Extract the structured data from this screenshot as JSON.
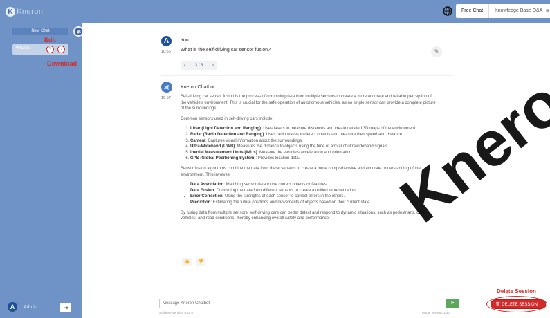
{
  "header": {
    "logo_text": "Kneron",
    "tabs": [
      {
        "label": "Free Chat",
        "active": true
      },
      {
        "label": "Knowledge Base Q&A",
        "active": false
      }
    ],
    "menu_label": "≡"
  },
  "sidebar": {
    "new_chat_label": "New Chat",
    "chat_item_text": "What is",
    "edit_annotation": "Edit",
    "download_annotation": "Download",
    "admin_initial": "A",
    "admin_name": "Admin"
  },
  "conversation": {
    "user": {
      "initial": "A",
      "name": "You :",
      "time": "10:56",
      "text": "What is the self-driving car sensor fusion?",
      "pager": "3 / 3"
    },
    "bot": {
      "name": "Kneron Chatbot :",
      "time": "10:57",
      "intro": "Self-driving car sensor fusion is the process of combining data from multiple sensors to create a more accurate and reliable perception of the vehicle's environment. This is crucial for the safe operation of autonomous vehicles, as no single sensor can provide a complete picture of the surroundings.",
      "sensors_intro": "Common sensors used in self-driving cars include:",
      "sensors": [
        {
          "term": "Lidar (Light Detection and Ranging)",
          "desc": ": Uses lasers to measure distances and create detailed 3D maps of the environment."
        },
        {
          "term": "Radar (Radio Detection and Ranging)",
          "desc": ": Uses radio waves to detect objects and measure their speed and distance."
        },
        {
          "term": "Camera",
          "desc": ": Captures visual information about the surroundings."
        },
        {
          "term": "Ultra-Wideband (UWB)",
          "desc": ": Measures the distance to objects using the time of arrival of ultrawideband signals."
        },
        {
          "term": "Inertial Measurement Units (IMUs)",
          "desc": ": Measure the vehicle's acceleration and orientation."
        },
        {
          "term": "GPS (Global Positioning System)",
          "desc": ": Provides location data."
        }
      ],
      "fusion_intro": "Sensor fusion algorithms combine the data from these sensors to create a more comprehensive and accurate understanding of the environment. This involves:",
      "steps": [
        {
          "term": "Data Association",
          "desc": ": Matching sensor data to the correct objects or features."
        },
        {
          "term": "Data Fusion",
          "desc": ": Combining the data from different sensors to create a unified representation."
        },
        {
          "term": "Error Correction",
          "desc": ": Using the strengths of each sensor to correct errors in the others."
        },
        {
          "term": "Prediction",
          "desc": ": Estimating the future positions and movements of objects based on their current state."
        }
      ],
      "conclusion": "By fusing data from multiple sensors, self-driving cars can better detect and respond to dynamic situations, such as pedestrians, other vehicles, and road conditions, thereby enhancing overall safety and performance."
    }
  },
  "footer": {
    "input_placeholder": "Message Kneron Chatbot",
    "software_version": "Software Version: 0.20.0",
    "model_version": "Model Version: 1.3.0",
    "delete_annotation": "Delete Session",
    "delete_label": "DELETE SESSION"
  },
  "watermark_text": "Kneron.us"
}
